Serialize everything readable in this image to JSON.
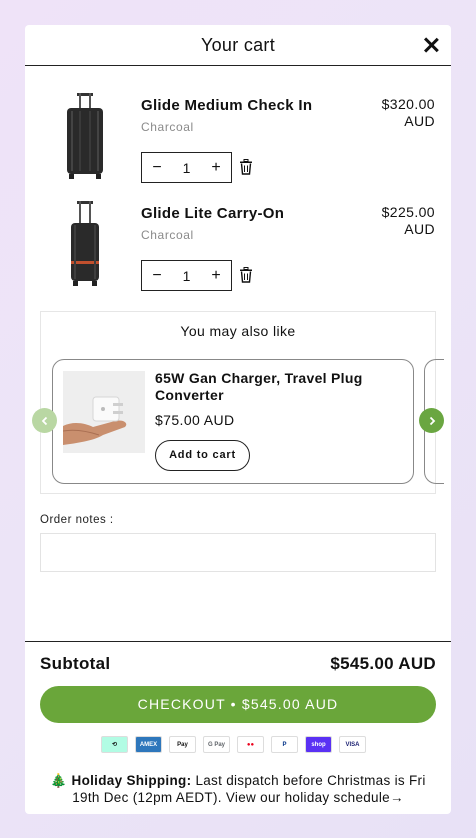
{
  "header": {
    "title": "Your cart"
  },
  "items": [
    {
      "name": "Glide Medium Check In",
      "variant": "Charcoal",
      "price_amount": "$320.00",
      "price_currency": "AUD",
      "quantity": "1"
    },
    {
      "name": "Glide Lite Carry-On",
      "variant": "Charcoal",
      "price_amount": "$225.00",
      "price_currency": "AUD",
      "quantity": "1"
    }
  ],
  "qty_controls": {
    "minus": "−",
    "plus": "+"
  },
  "upsell": {
    "heading": "You may also like",
    "product": {
      "name": "65W Gan Charger, Travel Plug Converter",
      "price": "$75.00 AUD",
      "button": "Add to cart"
    }
  },
  "notes": {
    "label": "Order notes :",
    "value": ""
  },
  "summary": {
    "subtotal_label": "Subtotal",
    "subtotal_value": "$545.00 AUD",
    "checkout_label": "CHECKOUT • $545.00 AUD"
  },
  "payment_methods": [
    {
      "name": "Afterpay",
      "label": "⟲",
      "color": "#b2fce4",
      "fg": "#111"
    },
    {
      "name": "American Express",
      "label": "AMEX",
      "color": "#2e77bc",
      "fg": "#fff"
    },
    {
      "name": "Apple Pay",
      "label": "Pay",
      "color": "#ffffff",
      "fg": "#111"
    },
    {
      "name": "Google Pay",
      "label": "G Pay",
      "color": "#ffffff",
      "fg": "#5f6368"
    },
    {
      "name": "Mastercard",
      "label": "●●",
      "color": "#ffffff",
      "fg": "#eb001b"
    },
    {
      "name": "PayPal",
      "label": "P",
      "color": "#ffffff",
      "fg": "#003087"
    },
    {
      "name": "Shop Pay",
      "label": "shop",
      "color": "#5a31f4",
      "fg": "#fff"
    },
    {
      "name": "Visa",
      "label": "VISA",
      "color": "#ffffff",
      "fg": "#1a1f71"
    }
  ],
  "shipping": {
    "icon": "🎄",
    "bold": "Holiday Shipping:",
    "text": "Last dispatch before Christmas is Fri 19th Dec (12pm AEDT). View our holiday schedule→"
  },
  "colors": {
    "accent": "#6aa63a",
    "accent_light": "#b9d7a3"
  }
}
